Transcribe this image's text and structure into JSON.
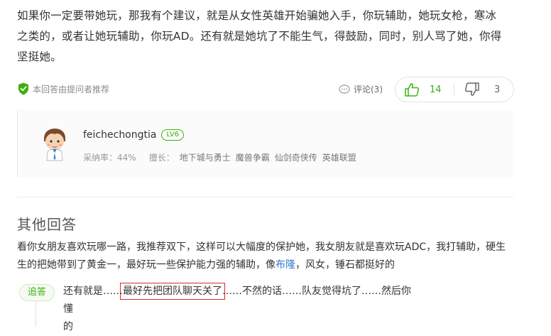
{
  "answer": {
    "line1": "如果你一定要带她玩，那我有个建议，就是从女性英雄开始骗她入手，你玩辅助，她玩女枪，寒冰",
    "line2": "之类的，或者让她玩辅助，你玩AD。还有就是她坑了不能生气，得鼓励，同时，别人骂了她，你得",
    "line3": "坚挺她。"
  },
  "recommend_text": "本回答由提问者推荐",
  "comment_label": "评论(3)",
  "votes": {
    "up_count": "14",
    "down_count": "3"
  },
  "user": {
    "name": "feichechongtia",
    "level": "LV6",
    "adoption": "采纳率：44%",
    "specialty_label": "擅长：",
    "tags": [
      "地下城与勇士",
      "魔兽争霸",
      "仙剑奇侠传",
      "英雄联盟"
    ]
  },
  "other_answers": {
    "title": "其他回答",
    "line1": "看你女朋友喜欢玩哪一路，我推荐双下，这样可以大幅度的保护她，我女朋友就是喜欢玩ADC，我打辅助，硬生",
    "line2_before": "生的把她带到了黄金一，最好玩一些保护能力强的辅助，像",
    "line2_link": "布隆",
    "line2_after": "，风女，锤石都挺好的"
  },
  "followup": {
    "badge": "追答",
    "text_before": "还有就是……",
    "text_highlight": "最好先把团队聊天关了",
    "text_after": "……不然的话……队友觉得坑了……然后你懂",
    "text_line2": "的"
  },
  "colors": {
    "accent_green": "#3eaf0e",
    "link_blue": "#2e7bcf",
    "highlight_red": "#d62b2b"
  }
}
